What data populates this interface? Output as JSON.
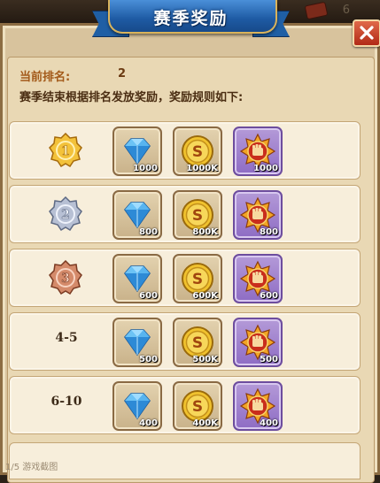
{
  "header": {
    "title": "赛季奖励",
    "corner_number": "6"
  },
  "current_rank": {
    "label": "当前排名:",
    "value": "2"
  },
  "rule_text": "赛季结束根据排名发放奖励，奖励规则如下:",
  "reward_types": [
    "diamond-icon",
    "gold-coin-icon",
    "honor-badge-icon"
  ],
  "rows": [
    {
      "rank": "1",
      "medal": "gold",
      "rewards": [
        "1000",
        "1000K",
        "1000"
      ]
    },
    {
      "rank": "2",
      "medal": "silver",
      "rewards": [
        "800",
        "800K",
        "800"
      ]
    },
    {
      "rank": "3",
      "medal": "bronze",
      "rewards": [
        "600",
        "600K",
        "600"
      ]
    },
    {
      "rank": "4-5",
      "medal": "",
      "rewards": [
        "500",
        "500K",
        "500"
      ]
    },
    {
      "rank": "6-10",
      "medal": "",
      "rewards": [
        "400",
        "400K",
        "400"
      ]
    }
  ],
  "watermark": "1/5 游戏截图",
  "colors": {
    "banner": "#1e5aa3",
    "close_button": "#b12a16",
    "gold": "#e0a92a",
    "purple_slot": "#8e6cc4"
  }
}
